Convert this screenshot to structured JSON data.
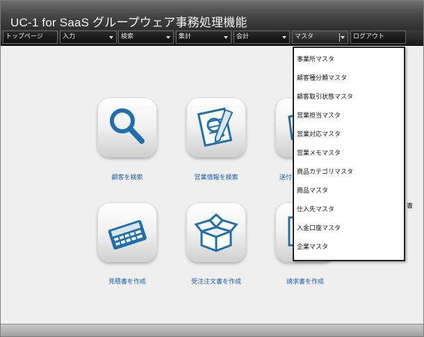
{
  "app": {
    "title": "UC-1 for SaaS グループウェア事務処理機能"
  },
  "nav": {
    "items": [
      {
        "label": "トップページ",
        "has_dropdown": false
      },
      {
        "label": "入力",
        "has_dropdown": true
      },
      {
        "label": "検索",
        "has_dropdown": true
      },
      {
        "label": "集計",
        "has_dropdown": true
      },
      {
        "label": "会計",
        "has_dropdown": true
      },
      {
        "label": "マスタ",
        "has_dropdown": true,
        "open": true
      },
      {
        "label": "ログアウト",
        "has_dropdown": false
      }
    ]
  },
  "tiles": [
    {
      "label": "顧客を検索",
      "icon": "magnifier-icon"
    },
    {
      "label": "営業情報を検索",
      "icon": "notepad-pencil-icon"
    },
    {
      "label": "送付",
      "icon": "send-document-icon"
    },
    {
      "label": "見積書を作成",
      "icon": "calculator-icon"
    },
    {
      "label": "受注注文書を作成",
      "icon": "open-box-icon"
    },
    {
      "label": "請求書を作成",
      "icon": "invoice-icon"
    }
  ],
  "dropdown": {
    "items": [
      "事業所マスタ",
      "顧客種分類マスタ",
      "顧客取引状態マスタ",
      "営業担当マスタ",
      "営業対応マスタ",
      "営業メモマスタ",
      "商品カテゴリマスタ",
      "商品マスタ",
      "仕入先マスタ",
      "入金口座マスタ",
      "企業マスタ"
    ]
  },
  "partial_text": "書",
  "colors": {
    "link": "#1a5fb4",
    "icon": "#1e6fb0",
    "titlebar": "#3a3a3a"
  }
}
